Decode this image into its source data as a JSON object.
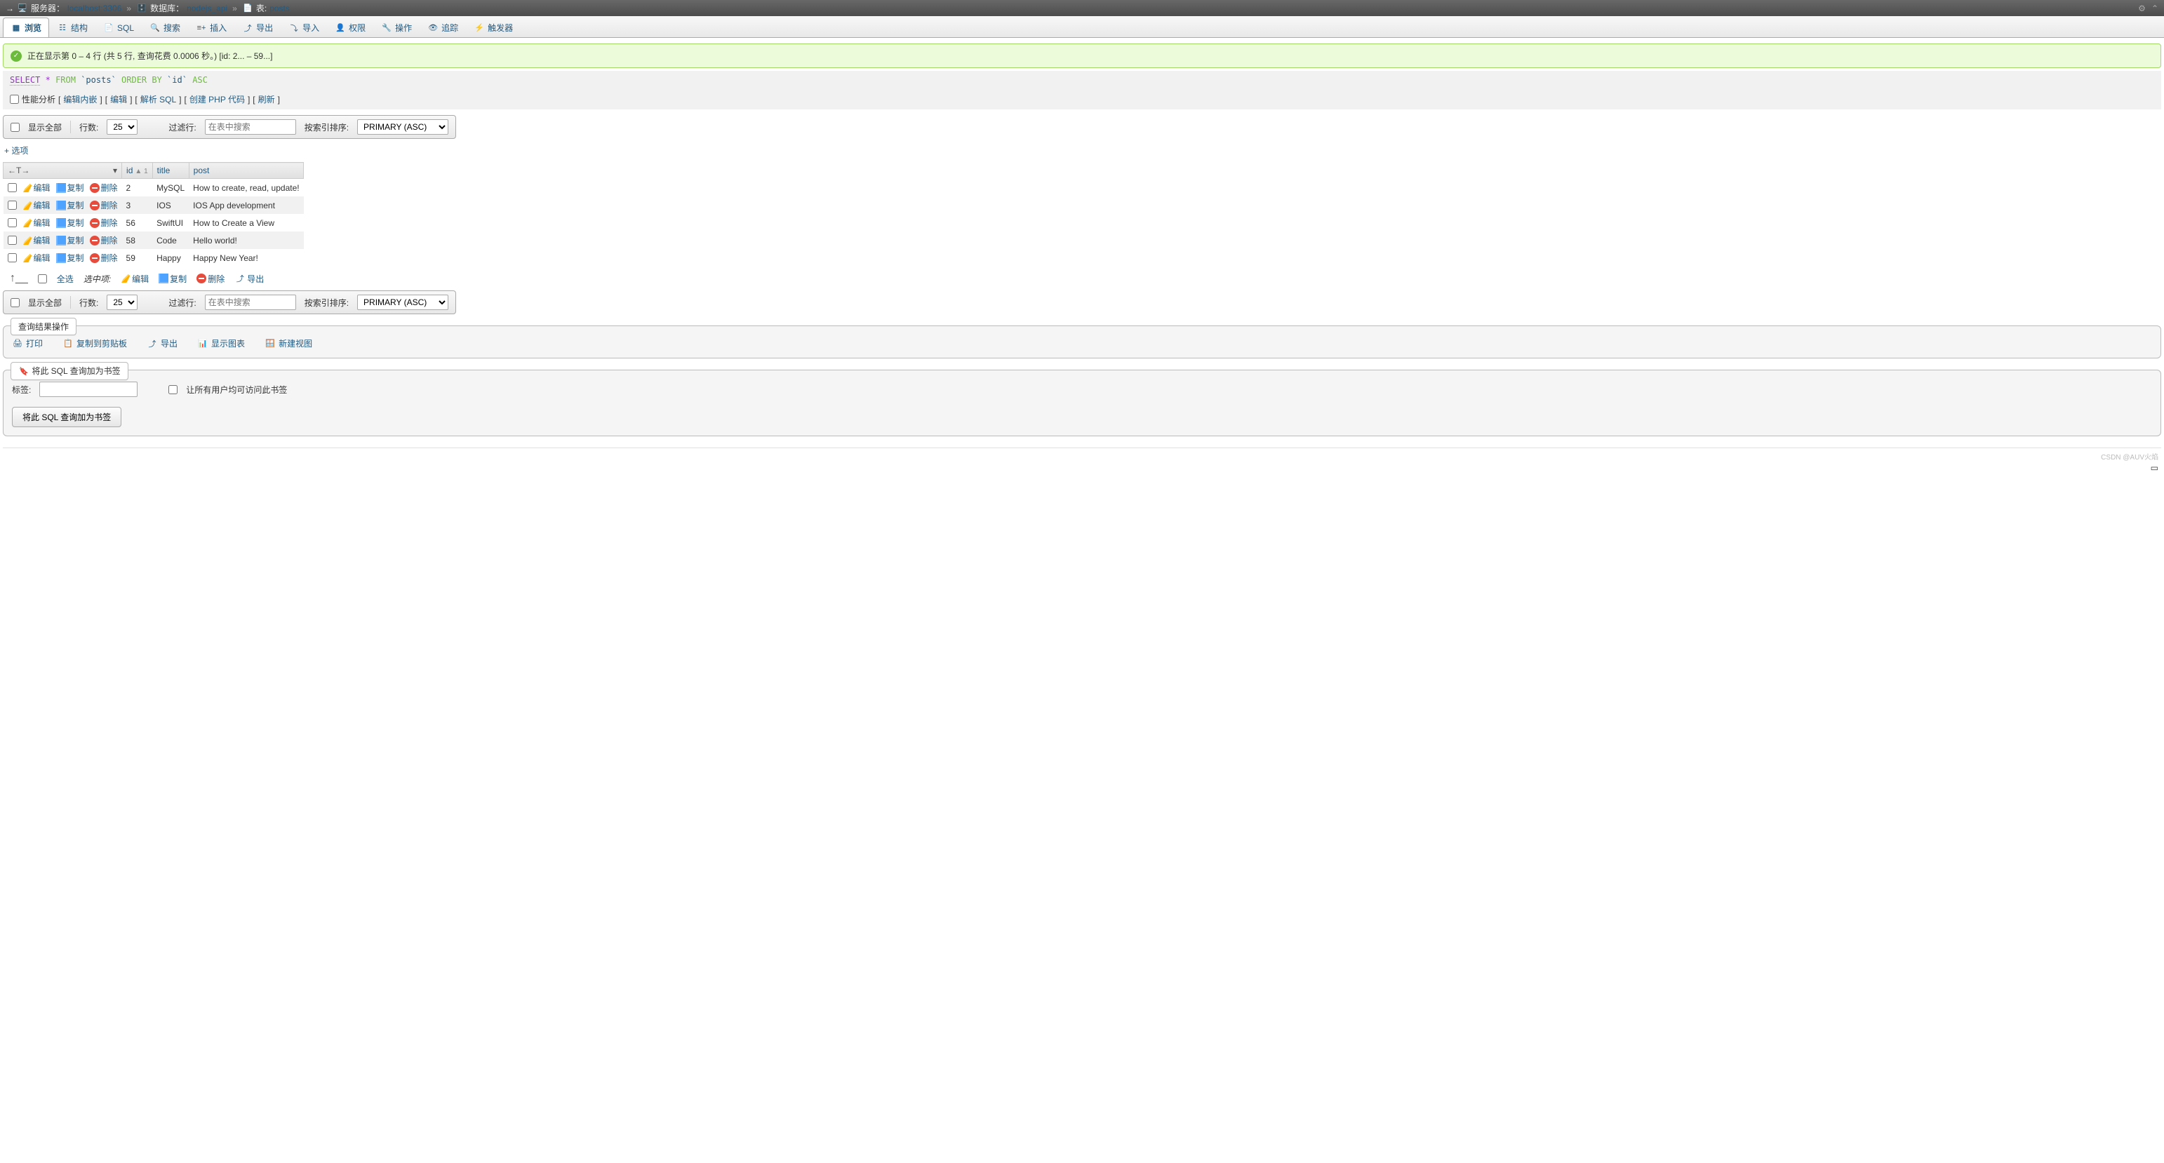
{
  "breadcrumb": {
    "server_lbl": "服务器：",
    "server_val": "localhost:3306",
    "db_lbl": "数据库：",
    "db_val": "nodejs_api",
    "tbl_lbl": "表:",
    "tbl_val": "posts"
  },
  "tabs": {
    "browse": "浏览",
    "structure": "结构",
    "sql": "SQL",
    "search": "搜索",
    "insert": "插入",
    "export": "导出",
    "import": "导入",
    "privileges": "权限",
    "operations": "操作",
    "tracking": "追踪",
    "triggers": "触发器"
  },
  "success_msg": "正在显示第 0 – 4 行 (共 5 行, 查询花费 0.0006 秒。) [id: 2... – 59...]",
  "sql": {
    "select": "SELECT",
    "star": "*",
    "from": "FROM",
    "table": "`posts`",
    "order": "ORDER BY",
    "col": "`id`",
    "dir": "ASC"
  },
  "linkbar": {
    "profiling": "性能分析",
    "edit_inline": "编辑内嵌",
    "edit": "编辑",
    "explain": "解析 SQL",
    "create_php": "创建 PHP 代码",
    "refresh": "刷新"
  },
  "controls": {
    "show_all": "显示全部",
    "rows_lbl": "行数:",
    "rows_val": "25",
    "filter_lbl": "过滤行:",
    "filter_ph": "在表中搜索",
    "sort_lbl": "按索引排序:",
    "sort_val": "PRIMARY (ASC)"
  },
  "options": "+ 选项",
  "headers": {
    "arrows": "←T→",
    "id": "id",
    "id_sort": "▲ 1",
    "title": "title",
    "post": "post"
  },
  "row_actions": {
    "edit": "编辑",
    "copy": "复制",
    "delete": "删除"
  },
  "rows": [
    {
      "id": "2",
      "title": "MySQL",
      "post": "How to create, read, update!"
    },
    {
      "id": "3",
      "title": "IOS",
      "post": "IOS App development"
    },
    {
      "id": "56",
      "title": "SwiftUI",
      "post": "How to Create a View"
    },
    {
      "id": "58",
      "title": "Code",
      "post": "Hello world!"
    },
    {
      "id": "59",
      "title": "Happy",
      "post": "Happy New Year!"
    }
  ],
  "bulk": {
    "check_all": "全选",
    "with_selected": "选中项:",
    "edit": "编辑",
    "copy": "复制",
    "delete": "删除",
    "export": "导出"
  },
  "result_ops": {
    "legend": "查询结果操作",
    "print": "打印",
    "copy_clip": "复制到剪贴板",
    "export": "导出",
    "chart": "显示图表",
    "create_view": "新建视图"
  },
  "bookmark": {
    "legend": "将此 SQL 查询加为书签",
    "label": "标签:",
    "share": "让所有用户均可访问此书签",
    "button": "将此 SQL 查询加为书签"
  },
  "watermark": "CSDN @AUV火焰"
}
